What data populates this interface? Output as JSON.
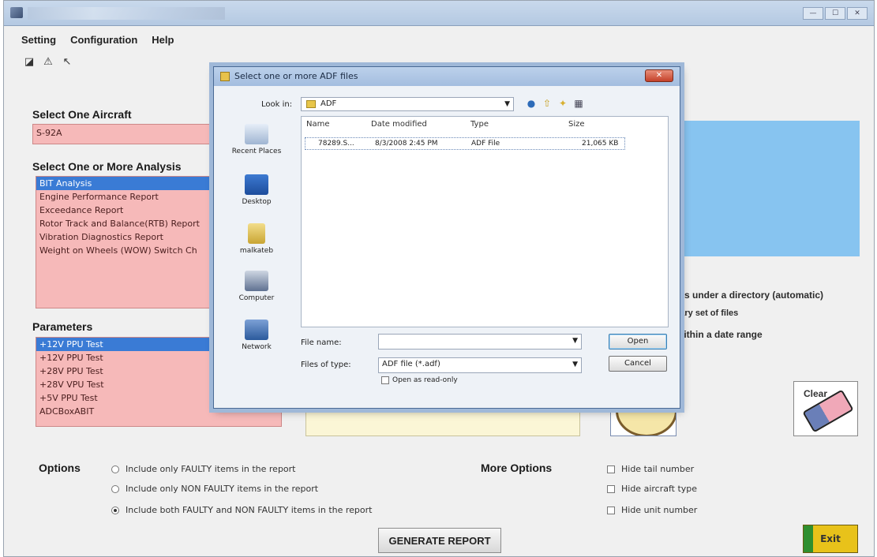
{
  "window": {
    "min_label": "—",
    "max_label": "☐",
    "close_label": "✕"
  },
  "menu": [
    "Setting",
    "Configuration",
    "Help"
  ],
  "toolbar_icons": [
    "chart-icon",
    "warning-icon",
    "wand-icon"
  ],
  "aircraft": {
    "heading": "Select One Aircraft",
    "selected": "S-92A"
  },
  "analysis": {
    "heading": "Select One or More Analysis",
    "items": [
      "BIT Analysis",
      "Engine Performance Report",
      "Exceedance Report",
      "Rotor Track and Balance(RTB) Report",
      "Vibration Diagnostics Report",
      "Weight on Wheels (WOW) Switch Ch"
    ],
    "selected_index": 0
  },
  "parameters": {
    "heading": "Parameters",
    "items": [
      "+12V PPU Test",
      "+12V PPU Test",
      "+28V PPU Test",
      "+28V VPU Test",
      "+5V PPU Test",
      "ADCBoxABIT"
    ],
    "selected_index": 0
  },
  "right_options": {
    "line1": "les under a directory (automatic)",
    "line2": "rary set of files",
    "line3": "within a date range"
  },
  "clear_button": {
    "label": "Clear"
  },
  "options": {
    "title": "Options",
    "radios": [
      {
        "label": "Include only FAULTY items in the report",
        "checked": false
      },
      {
        "label": "Include only NON FAULTY items in the report",
        "checked": false
      },
      {
        "label": "Include both FAULTY and NON FAULTY items in the report",
        "checked": true
      }
    ]
  },
  "more_options": {
    "title": "More Options",
    "checks": [
      {
        "label": "Hide tail number",
        "checked": false
      },
      {
        "label": "Hide aircraft type",
        "checked": false
      },
      {
        "label": "Hide unit number",
        "checked": false
      }
    ]
  },
  "generate_button": "GENERATE REPORT",
  "exit_button": "Exit",
  "dialog": {
    "title": "Select one or more ADF files",
    "close": "✕",
    "look_in_label": "Look in:",
    "look_in_value": "ADF",
    "places": [
      "Recent Places",
      "Desktop",
      "malkateb",
      "Computer",
      "Network"
    ],
    "columns": [
      "Name",
      "Date modified",
      "Type",
      "Size"
    ],
    "files": [
      {
        "name": "78289.S...",
        "date": "8/3/2008 2:45 PM",
        "type": "ADF File",
        "size": "21,065 KB"
      }
    ],
    "file_name_label": "File name:",
    "file_name_value": "",
    "files_of_type_label": "Files of type:",
    "files_of_type_value": "ADF file (*.adf)",
    "open_button": "Open",
    "cancel_button": "Cancel",
    "read_only_label": "Open as read-only"
  }
}
